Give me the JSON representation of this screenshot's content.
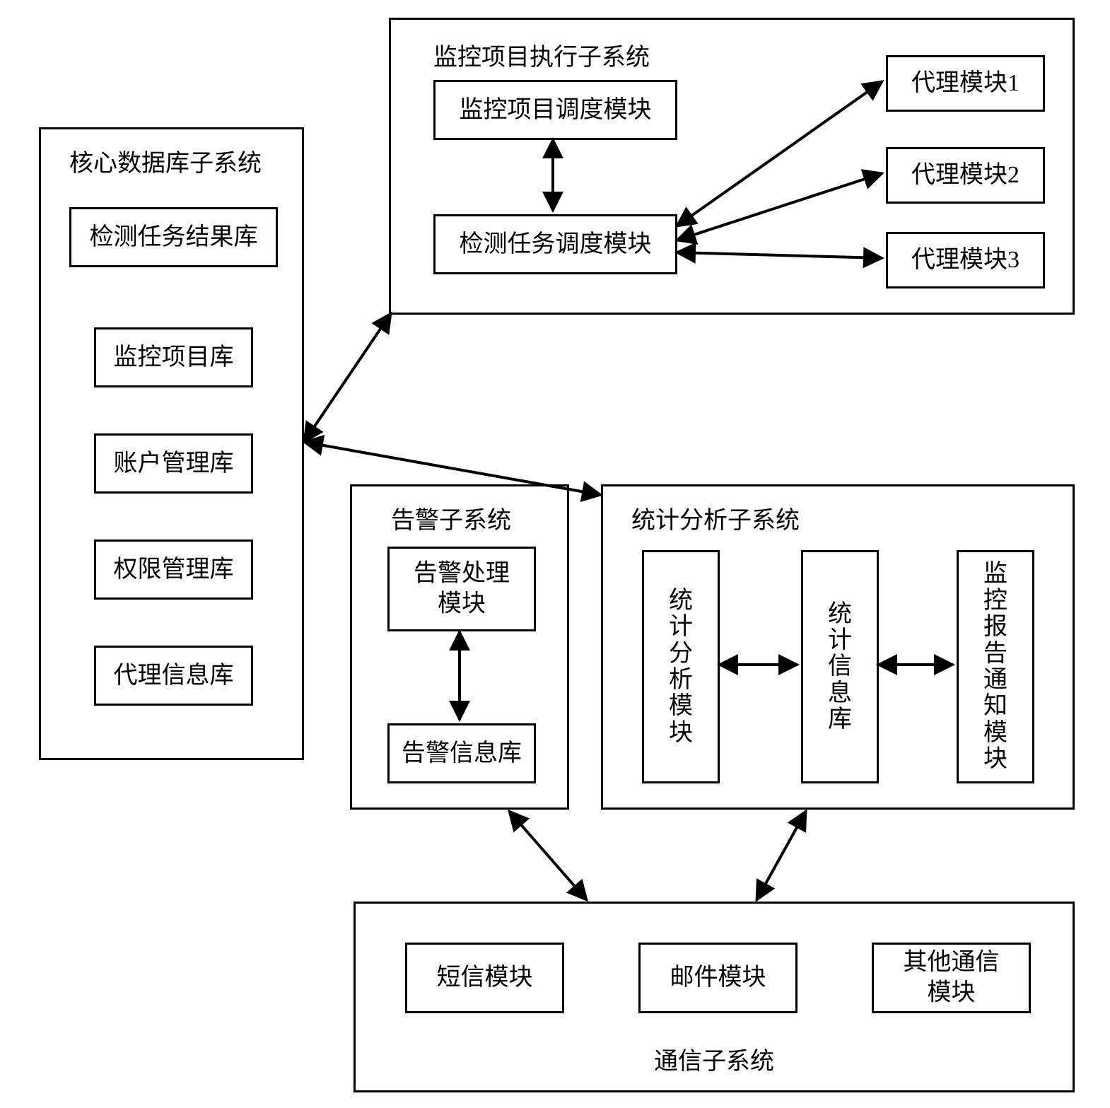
{
  "core_db": {
    "title": "核心数据库子系统",
    "items": {
      "results": "检测任务结果库",
      "projects": "监控项目库",
      "accounts": "账户管理库",
      "perms": "权限管理库",
      "agents": "代理信息库"
    }
  },
  "exec": {
    "title": "监控项目执行子系统",
    "project_sched": "监控项目调度模块",
    "task_sched": "检测任务调度模块",
    "agent1": "代理模块1",
    "agent2": "代理模块2",
    "agent3": "代理模块3"
  },
  "alarm": {
    "title": "告警子系统",
    "handler": "告警处理\n模块",
    "store": "告警信息库"
  },
  "stats": {
    "title": "统计分析子系统",
    "analysis": "统计分析模块",
    "store": "统计信息库",
    "report": "监控报告通知模块"
  },
  "comm": {
    "title": "通信子系统",
    "sms": "短信模块",
    "mail": "邮件模块",
    "other": "其他通信\n模块"
  }
}
